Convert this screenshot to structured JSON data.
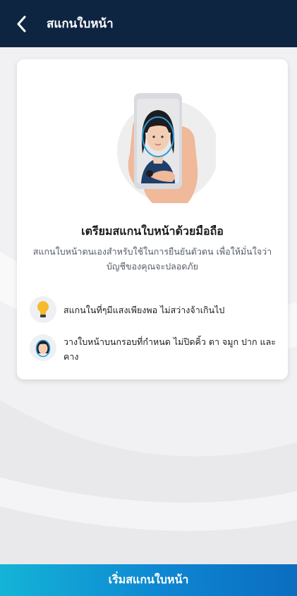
{
  "header": {
    "title": "สแกนใบหน้า",
    "back_icon": "chevron-left-icon"
  },
  "card": {
    "illustration": "face-scan-phone-illustration",
    "title": "เตรียมสแกนใบหน้าด้วยมือถือ",
    "description": "สแกนใบหน้าตนเองสำหรับใช้ในการยืนยันตัวตน เพื่อให้มั่นใจว่าบัญชีของคุณจะปลอดภัย",
    "tips": [
      {
        "icon": "lightbulb-icon",
        "text": "สแกนในที่ๆมีแสงเพียงพอ ไม่สว่างจ้าเกินไป"
      },
      {
        "icon": "face-frame-icon",
        "text": "วางใบหน้าบนกรอบที่กำหนด ไม่ปิดคิ้ว ตา จมูก ปาก และคาง"
      }
    ]
  },
  "footer": {
    "start_label": "เริ่มสแกนใบหน้า"
  },
  "colors": {
    "header_bg": "#0e2542",
    "accent_start": "#14b4d6",
    "accent_end": "#0b6dbf",
    "page_bg": "#f1f1f3"
  }
}
